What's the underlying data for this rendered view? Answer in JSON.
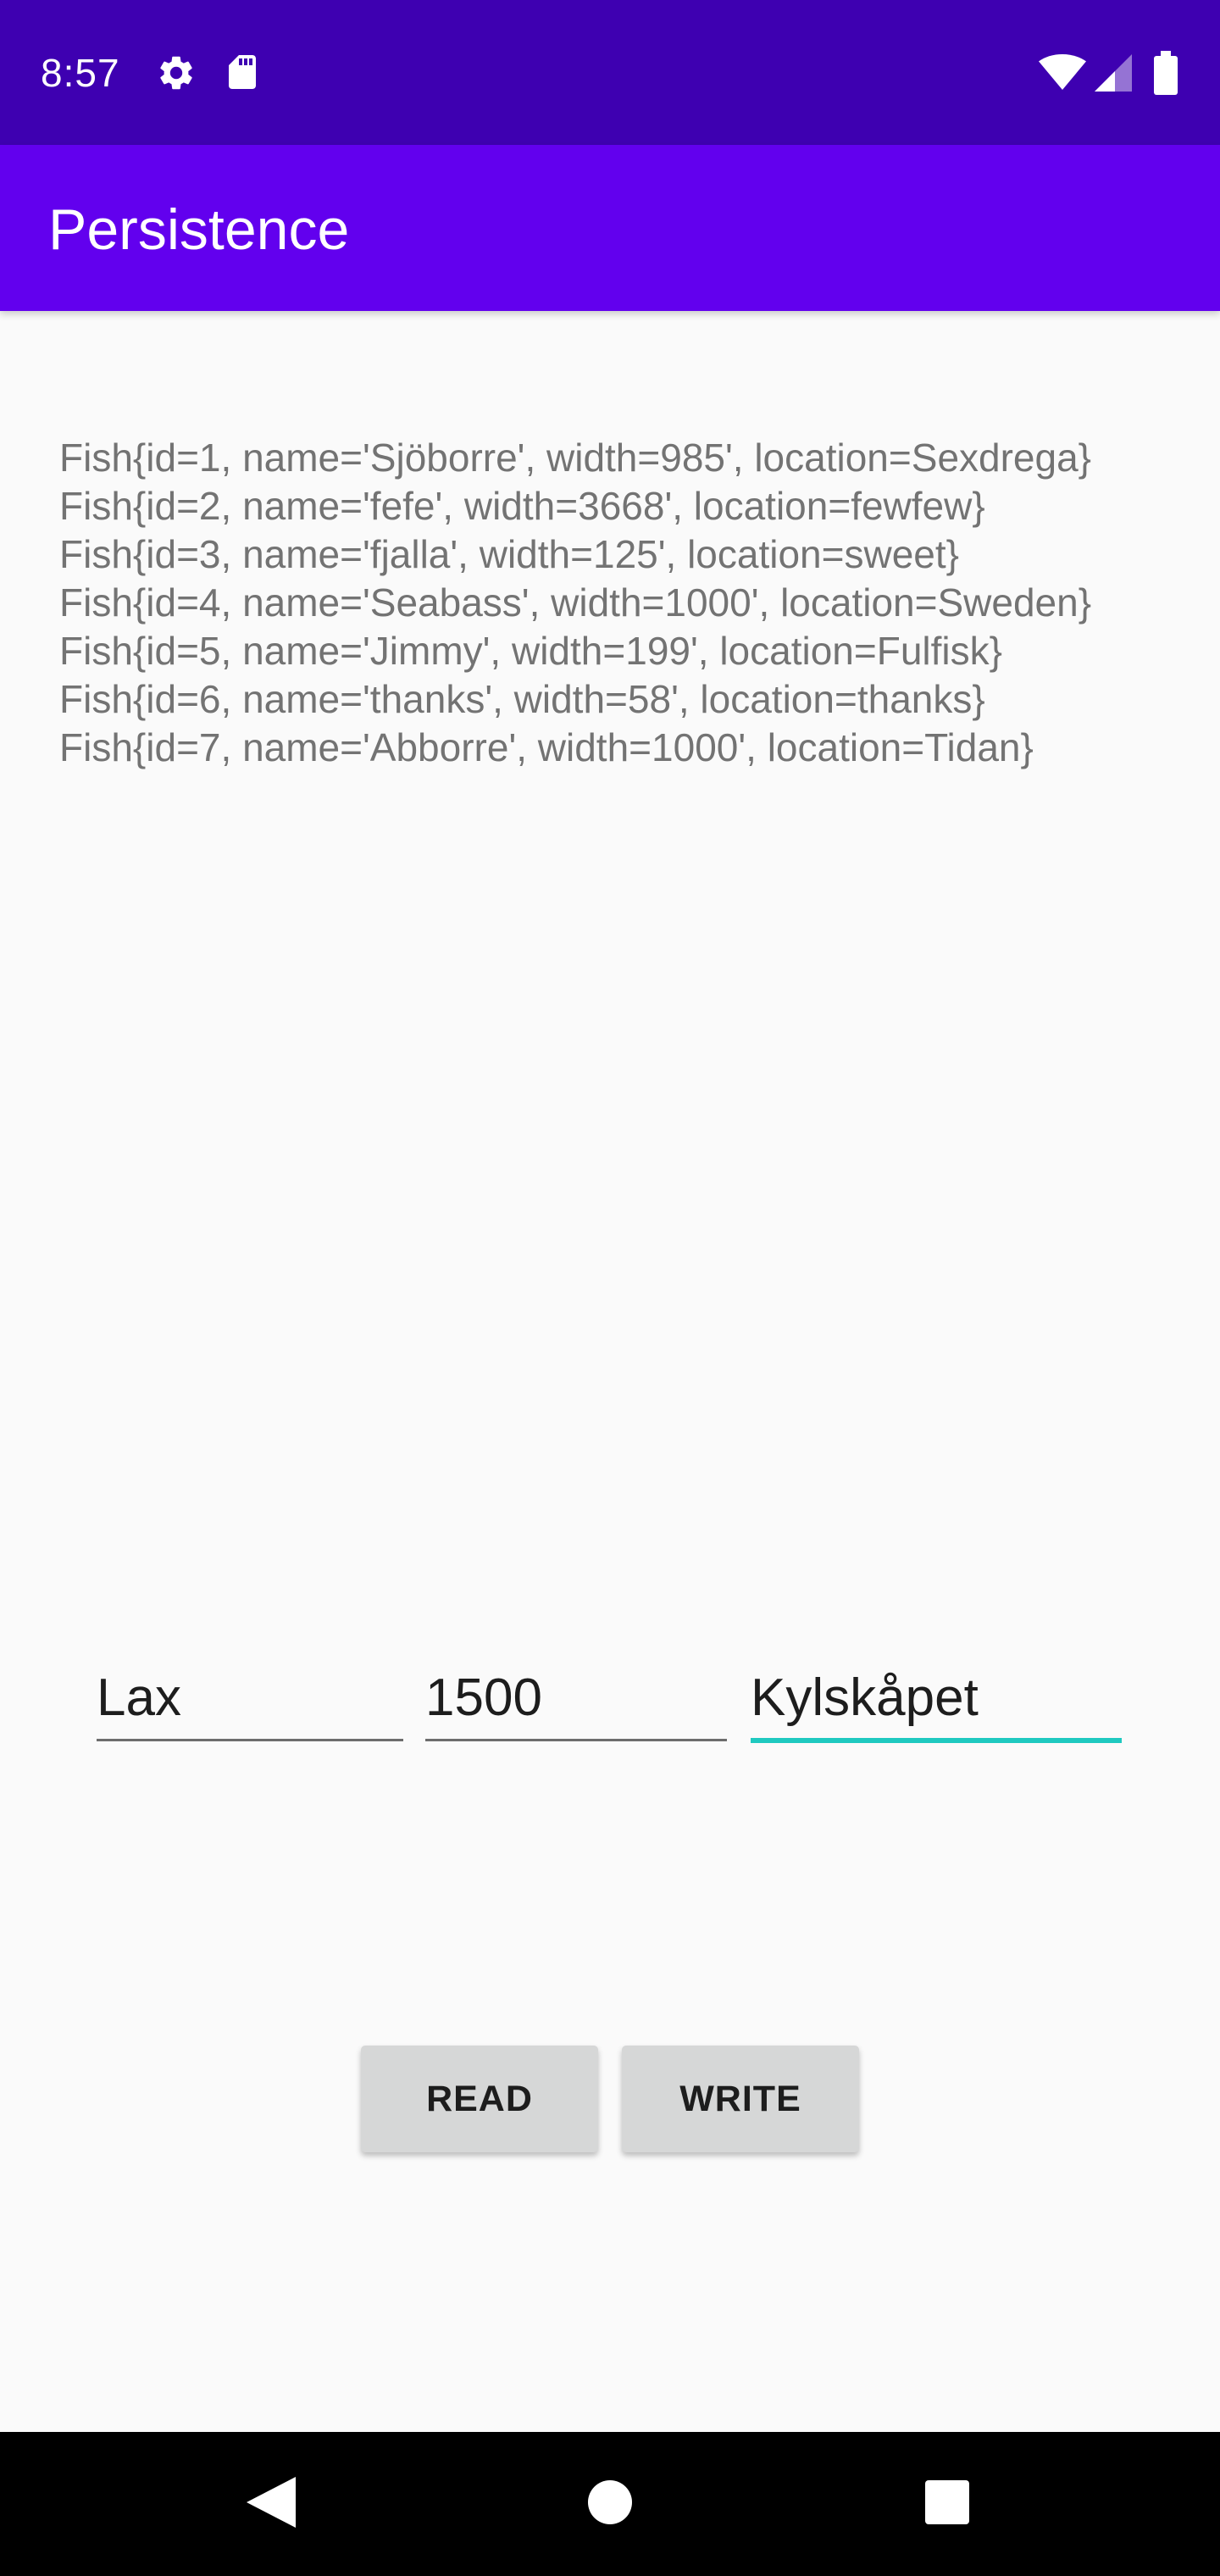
{
  "status_bar": {
    "time": "8:57",
    "left_icons": [
      "gear-icon",
      "sd-card-icon"
    ],
    "right_icons": [
      "wifi-icon",
      "cell-signal-icon",
      "battery-icon"
    ]
  },
  "app_bar": {
    "title": "Persistence",
    "color": "#6200ee"
  },
  "fish_list": [
    "Fish{id=1, name='Sjöborre', width=985', location=Sexdrega}",
    "Fish{id=2, name='fefe', width=3668', location=fewfew}",
    "Fish{id=3, name='fjalla', width=125', location=sweet}",
    "Fish{id=4, name='Seabass', width=1000', location=Sweden}",
    "Fish{id=5, name='Jimmy', width=199', location=Fulfisk}",
    "Fish{id=6, name='thanks', width=58', location=thanks}",
    "Fish{id=7, name='Abborre', width=1000', location=Tidan}"
  ],
  "inputs": {
    "name": "Lax",
    "width": "1500",
    "location": "Kylskåpet",
    "focused_accent": "#1fc9c0"
  },
  "buttons": {
    "read": "READ",
    "write": "WRITE"
  },
  "nav_bar": {
    "icons": [
      "back-icon",
      "home-icon",
      "recents-icon"
    ]
  }
}
